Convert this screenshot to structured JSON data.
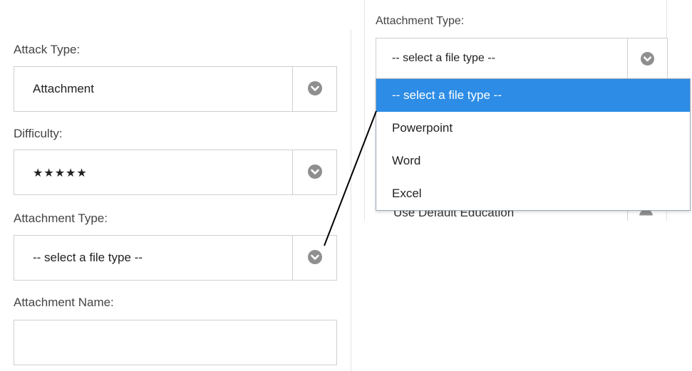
{
  "form": {
    "attack_type": {
      "label": "Attack Type:",
      "value": "Attachment"
    },
    "difficulty": {
      "label": "Difficulty:",
      "value": "★★★★★"
    },
    "attachment_type": {
      "label": "Attachment Type:",
      "value": "-- select a file type --"
    },
    "attachment_name": {
      "label": "Attachment Name:",
      "value": ""
    }
  },
  "zoom_panel": {
    "attachment_type_label": "Attachment Type:",
    "select_value": "-- select a file type --",
    "options": [
      {
        "label": "-- select a file type --",
        "selected": true
      },
      {
        "label": "Powerpoint",
        "selected": false
      },
      {
        "label": "Word",
        "selected": false
      },
      {
        "label": "Excel",
        "selected": false
      }
    ],
    "obscured_field_value": "Use Default Education"
  },
  "colors": {
    "selected_option_bg": "#2c8ce6",
    "chevron_circle": "#8f8f8f",
    "border": "#cfcfcf"
  },
  "icons": {
    "dropdown_chevron": "chevron-down-icon"
  }
}
